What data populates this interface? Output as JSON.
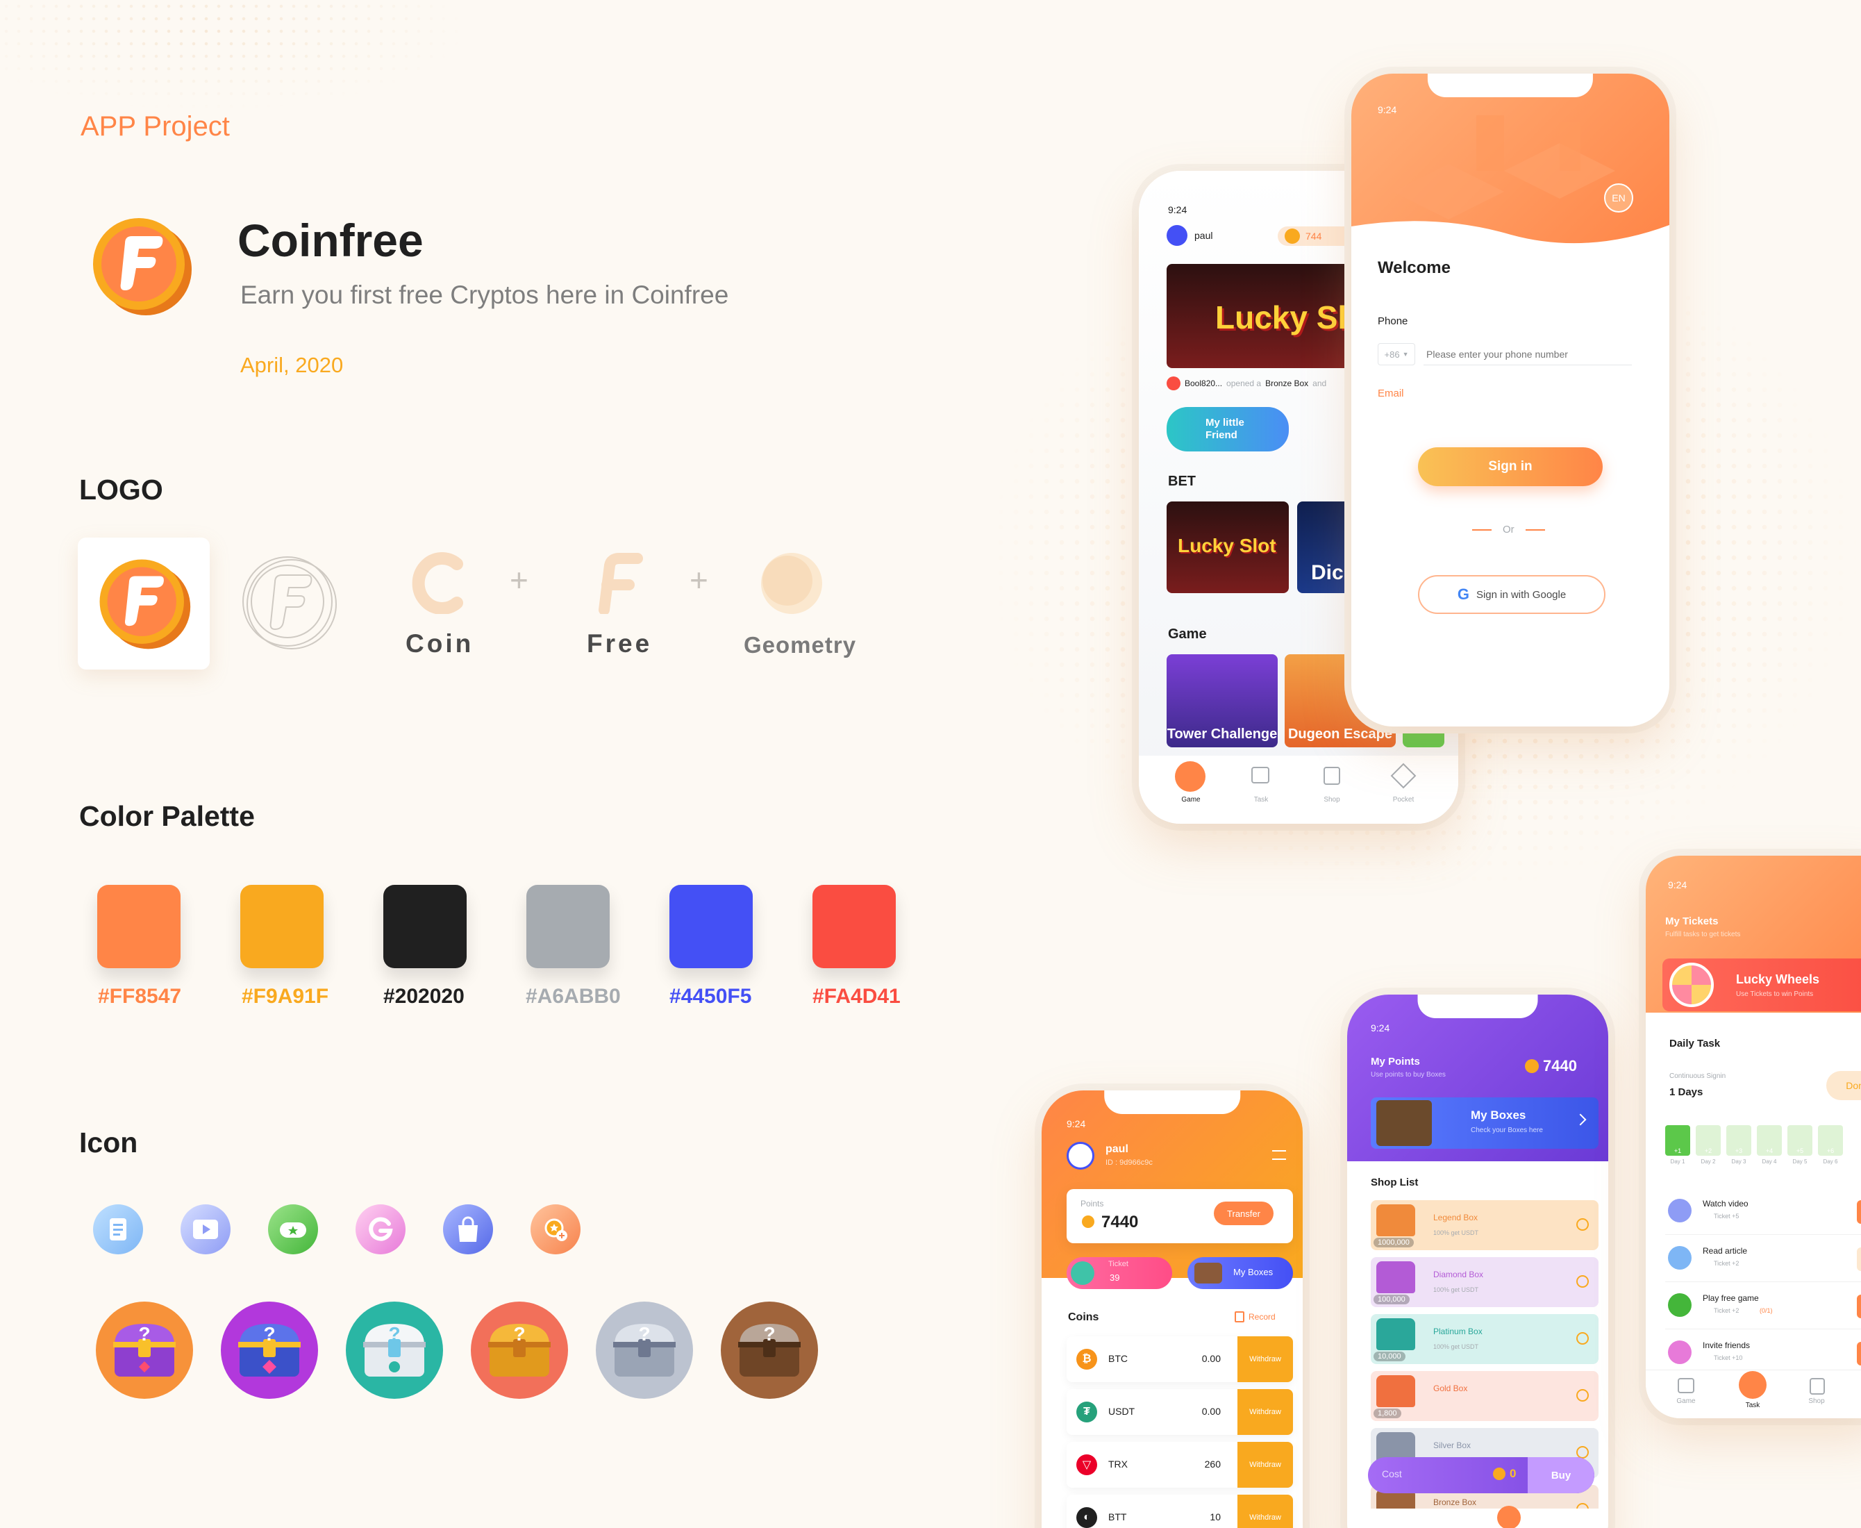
{
  "header": {
    "project_tag": "APP Project",
    "title": "Coinfree",
    "subtitle": "Earn you first free Cryptos here in Coinfree",
    "date": "April, 2020"
  },
  "logo_section": {
    "title": "LOGO",
    "concepts": [
      "Coin",
      "Free",
      "Geometry"
    ],
    "plus": "+"
  },
  "palette_section": {
    "title": "Color Palette",
    "colors": [
      "#FF8547",
      "#F9A91F",
      "#202020",
      "#A6ABB0",
      "#4450F5",
      "#FA4D41"
    ]
  },
  "icon_section": {
    "title": "Icon",
    "small_icons": [
      "article-icon",
      "video-icon",
      "game-icon",
      "google-icon",
      "shop-icon",
      "coin-exchange-icon"
    ],
    "chests": [
      "legend-chest-icon",
      "diamond-chest-icon",
      "platinum-chest-icon",
      "gold-chest-icon",
      "silver-chest-icon",
      "bronze-chest-icon"
    ]
  },
  "phone_game": {
    "time": "9:24",
    "user": "paul",
    "points_partial": "744",
    "banner": "Lucky Sl",
    "feed_user": "Bool820...",
    "feed_action": "opened a",
    "feed_box": "Bronze Box",
    "feed_more": "and",
    "friend_banner": "My little Friend",
    "bet_title": "BET",
    "bet_cards": [
      "Lucky Slot",
      "Dic"
    ],
    "game_title": "Game",
    "game_cards": [
      "Tower Challenge",
      "Dugeon Escape"
    ],
    "nav": [
      "Game",
      "Task",
      "Shop",
      "Pocket"
    ]
  },
  "phone_login": {
    "time": "9:24",
    "lang": "EN",
    "welcome": "Welcome",
    "phone_label": "Phone",
    "country_code": "+86",
    "phone_placeholder": "Please enter your phone number",
    "email_label": "Email",
    "signin": "Sign in",
    "or": "Or",
    "google": "Sign in with Google"
  },
  "phone_wallet": {
    "time": "9:24",
    "user": "paul",
    "user_id": "ID : 9d966c9c",
    "points_label": "Points",
    "points": "7440",
    "transfer": "Transfer",
    "ticket_label": "Ticket",
    "ticket_count": "39",
    "my_boxes": "My Boxes",
    "coins_title": "Coins",
    "record": "Record",
    "coins": [
      {
        "name": "BTC",
        "value": "0.00",
        "action": "Withdraw",
        "color": "#f7931a",
        "glyph": "₿"
      },
      {
        "name": "USDT",
        "value": "0.00",
        "action": "Withdraw",
        "color": "#26a17b",
        "glyph": "₮"
      },
      {
        "name": "TRX",
        "value": "260",
        "action": "Withdraw",
        "color": "#eb0029",
        "glyph": "▽"
      },
      {
        "name": "BTT",
        "value": "10",
        "action": "Withdraw",
        "color": "#202020",
        "glyph": "◐"
      }
    ]
  },
  "phone_shop": {
    "time": "9:24",
    "title": "My Points",
    "subtitle": "Use points to buy Boxes",
    "points": "7440",
    "my_boxes": "My Boxes",
    "my_boxes_sub": "Check your Boxes here",
    "shop_list": "Shop List",
    "boxes": [
      {
        "name": "Legend Box",
        "price": "1000,000",
        "note": "100% get USDT",
        "bg": "#fde3c4",
        "accent": "#f08a3b"
      },
      {
        "name": "Diamond Box",
        "price": "100,000",
        "note": "100% get USDT",
        "bg": "#efe1f7",
        "accent": "#b35bd6"
      },
      {
        "name": "Platinum Box",
        "price": "10,000",
        "note": "100% get USDT",
        "bg": "#d6f2ee",
        "accent": "#2aa79a"
      },
      {
        "name": "Gold Box",
        "price": "1,800",
        "note": "",
        "bg": "#fde5df",
        "accent": "#f0703f"
      },
      {
        "name": "Silver Box",
        "price": "",
        "note": "",
        "bg": "#e8ebf0",
        "accent": "#8a94a8"
      },
      {
        "name": "Bronze Box",
        "price": "",
        "note": "",
        "bg": "#f6e4d8",
        "accent": "#a0643b"
      }
    ],
    "cost_label": "Cost",
    "cost_value": "0",
    "buy": "Buy"
  },
  "phone_tasks": {
    "time": "9:24",
    "title": "My Tickets",
    "subtitle": "Fulfill tasks to get tickets",
    "wheel_title": "Lucky Wheels",
    "wheel_sub": "Use Tickets to win Points",
    "daily_task": "Daily Task",
    "signin_label": "Continuous Signin",
    "signin_days": "1 Days",
    "done": "Done",
    "days": [
      "Day 1",
      "Day 2",
      "Day 3",
      "Day 4",
      "Day 5",
      "Day 6"
    ],
    "day_rewards": [
      "+1",
      "+2",
      "+3",
      "+4",
      "+5",
      "+6"
    ],
    "tasks": [
      {
        "name": "Watch video",
        "reward": "Ticket +5",
        "extra": "",
        "action": "Watc"
      },
      {
        "name": "Read article",
        "reward": "Ticket +2",
        "extra": "",
        "action": "Don"
      },
      {
        "name": "Play free game",
        "reward": "Ticket +2",
        "extra": "(0/1)",
        "action": "Go"
      },
      {
        "name": "Invite friends",
        "reward": "Ticket +10",
        "extra": "",
        "action": "Go"
      }
    ],
    "nav": [
      "Game",
      "Task",
      "Shop"
    ]
  }
}
